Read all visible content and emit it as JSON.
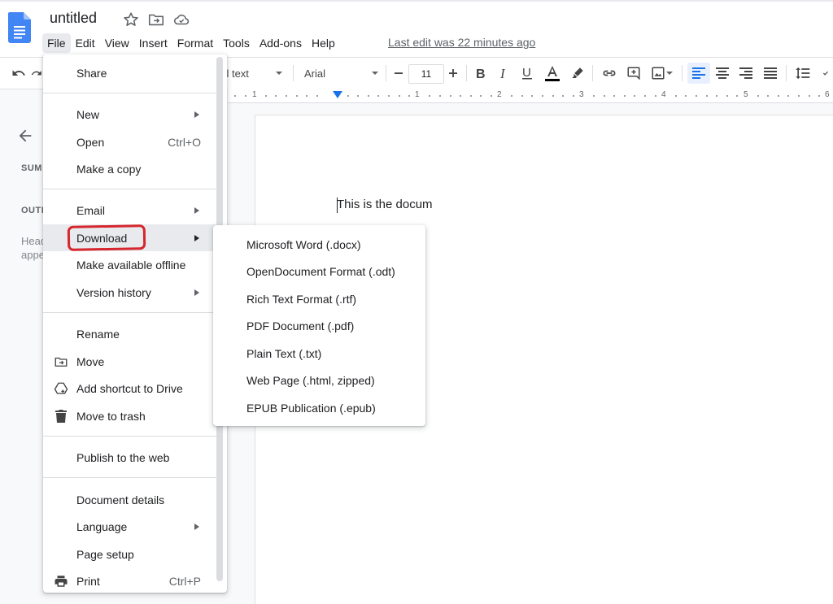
{
  "doc": {
    "title": "untitled",
    "last_edit": "Last edit was 22 minutes ago",
    "body_text": "This is the docum"
  },
  "menubar": {
    "items": [
      "File",
      "Edit",
      "View",
      "Insert",
      "Format",
      "Tools",
      "Add-ons",
      "Help"
    ],
    "active": "File"
  },
  "toolbar": {
    "style_label": "nal text",
    "font_label": "Arial",
    "font_size": "11",
    "text_color": "#000000",
    "accent_color": "#1a73e8"
  },
  "ruler": {
    "numbers": [
      "1",
      "1",
      "2",
      "3",
      "4",
      "5",
      "6"
    ]
  },
  "left_panel": {
    "summary_label": "SUM",
    "outline_label": "OUTL",
    "hint_line1": "Head",
    "hint_line2": "appe"
  },
  "file_menu": {
    "share": "Share",
    "new": "New",
    "open": "Open",
    "open_shortcut": "Ctrl+O",
    "make_copy": "Make a copy",
    "email": "Email",
    "download": "Download",
    "offline": "Make available offline",
    "version_history": "Version history",
    "rename": "Rename",
    "move": "Move",
    "add_shortcut": "Add shortcut to Drive",
    "trash": "Move to trash",
    "publish": "Publish to the web",
    "details": "Document details",
    "language": "Language",
    "page_setup": "Page setup",
    "print": "Print",
    "print_shortcut": "Ctrl+P"
  },
  "download_menu": {
    "items": [
      "Microsoft Word (.docx)",
      "OpenDocument Format (.odt)",
      "Rich Text Format (.rtf)",
      "PDF Document (.pdf)",
      "Plain Text (.txt)",
      "Web Page (.html, zipped)",
      "EPUB Publication (.epub)"
    ]
  },
  "annotation": {
    "highlight_color": "#d6262e"
  }
}
